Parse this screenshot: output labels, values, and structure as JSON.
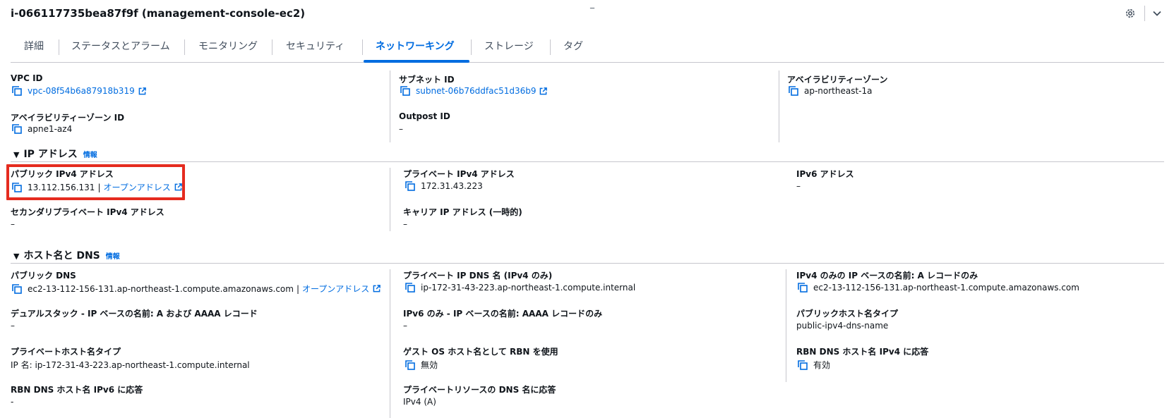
{
  "header": {
    "title": "i-066117735bea87f9f (management-console-ec2)",
    "top_mark": "_"
  },
  "tabs": [
    {
      "label": "詳細"
    },
    {
      "label": "ステータスとアラーム"
    },
    {
      "label": "モニタリング"
    },
    {
      "label": "セキュリティ"
    },
    {
      "label": "ネットワーキング",
      "active": true
    },
    {
      "label": "ストレージ"
    },
    {
      "label": "タグ"
    }
  ],
  "network": {
    "vpc_id_label": "VPC ID",
    "vpc_id_value": "vpc-08f54b6a87918b319",
    "subnet_id_label": "サブネット ID",
    "subnet_id_value": "subnet-06b76ddfac51d36b9",
    "az_label": "アベイラビリティーゾーン",
    "az_value": "ap-northeast-1a",
    "az_id_label": "アベイラビリティーゾーン ID",
    "az_id_value": "apne1-az4",
    "outpost_label": "Outpost ID",
    "outpost_value": "–"
  },
  "ip_section": {
    "heading": "IP アドレス",
    "info": "情報",
    "public_ipv4_label": "パブリック IPv4 アドレス",
    "public_ipv4_value": "13.112.156.131",
    "separator": "|",
    "open_address": "オープンアドレス",
    "private_ipv4_label": "プライベート IPv4 アドレス",
    "private_ipv4_value": "172.31.43.223",
    "ipv6_label": "IPv6 アドレス",
    "ipv6_value": "–",
    "secondary_private_label": "セカンダリプライベート IPv4 アドレス",
    "secondary_private_value": "–",
    "carrier_ip_label": "キャリア IP アドレス (一時的)",
    "carrier_ip_value": "–"
  },
  "dns_section": {
    "heading": "ホスト名と DNS",
    "info": "情報",
    "public_dns_label": "パブリック DNS",
    "public_dns_value": "ec2-13-112-156-131.ap-northeast-1.compute.amazonaws.com",
    "separator": "|",
    "open_address": "オープンアドレス",
    "private_ip_dns_label": "プライベート IP DNS 名 (IPv4 のみ)",
    "private_ip_dns_value": "ip-172-31-43-223.ap-northeast-1.compute.internal",
    "ipv4_ip_name_label": "IPv4 のみの IP ベースの名前: A レコードのみ",
    "ipv4_ip_name_value": "ec2-13-112-156-131.ap-northeast-1.compute.amazonaws.com",
    "dualstack_label": "デュアルスタック - IP ベースの名前: A および AAAA レコード",
    "dualstack_value": "–",
    "ipv6_only_label": "IPv6 のみ - IP ベースの名前: AAAA レコードのみ",
    "ipv6_only_value": "–",
    "public_hostname_type_label": "パブリックホスト名タイプ",
    "public_hostname_type_value": "public-ipv4-dns-name",
    "private_hostname_type_label": "プライベートホスト名タイプ",
    "private_hostname_type_value": "IP 名: ip-172-31-43-223.ap-northeast-1.compute.internal",
    "guest_os_rbn_label": "ゲスト OS ホスト名として RBN を使用",
    "guest_os_rbn_value": "無効",
    "rbn_ipv4_label": "RBN DNS ホスト名 IPv4 に応答",
    "rbn_ipv4_value": "有効",
    "rbn_ipv6_label": "RBN DNS ホスト名 IPv6 に応答",
    "rbn_ipv6_value": "-",
    "private_resource_dns_label": "プライベートリソースの DNS 名に応答",
    "private_resource_dns_value": "IPv4 (A)"
  }
}
